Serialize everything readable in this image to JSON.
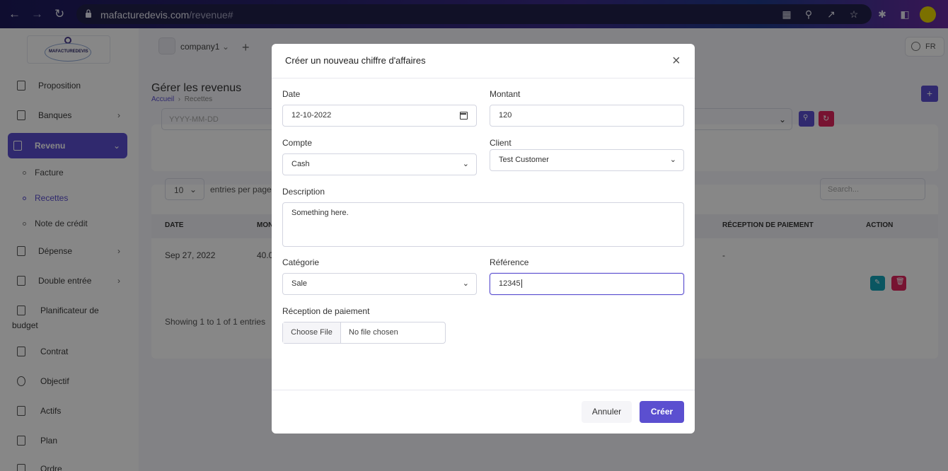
{
  "browser": {
    "url_host": "mafacturedevis.com",
    "url_path": "/revenue#"
  },
  "topbar": {
    "company": "company1",
    "lang": "FR"
  },
  "sidebar": {
    "items": [
      {
        "label": "Proposition"
      },
      {
        "label": "Banques"
      },
      {
        "label": "Revenu"
      },
      {
        "label": "Dépense"
      },
      {
        "label": "Double entrée"
      },
      {
        "label": "Planificateur de"
      },
      {
        "label": "budget"
      },
      {
        "label": "Contrat"
      },
      {
        "label": "Objectif"
      },
      {
        "label": "Actifs"
      },
      {
        "label": "Plan"
      },
      {
        "label": "Ordre"
      }
    ],
    "sub_items": [
      {
        "label": "Facture"
      },
      {
        "label": "Recettes"
      },
      {
        "label": "Note de crédit"
      }
    ]
  },
  "main": {
    "title": "Gérer les revenus",
    "breadcrumb_home": "Accueil",
    "breadcrumb_current": "Recettes",
    "filter_date_placeholder": "YYYY-MM-DD",
    "entries_value": "10",
    "entries_label": "entries per page",
    "search_placeholder": "Search...",
    "table_headers": [
      "DATE",
      "MON",
      "RÉCEPTION DE PAIEMENT",
      "ACTION"
    ],
    "row": {
      "date": "Sep 27, 2022",
      "amount": "40.0",
      "receipt": "-"
    },
    "showing": "Showing 1 to 1 of 1 entries"
  },
  "modal": {
    "title": "Créer un nouveau chiffre d'affaires",
    "close": "×",
    "date_label": "Date",
    "date_value": "12-10-2022",
    "amount_label": "Montant",
    "amount_value": "120",
    "account_label": "Compte",
    "account_value": "Cash",
    "client_label": "Client",
    "client_value": "Test Customer",
    "description_label": "Description",
    "description_value": "Something here.",
    "category_label": "Catégorie",
    "category_value": "Sale",
    "reference_label": "Référence",
    "reference_value": "12345",
    "payment_label": "Réception de paiement",
    "file_button": "Choose File",
    "file_status": "No file chosen",
    "cancel": "Annuler",
    "create": "Créer"
  },
  "colors": {
    "accent": "#5b4fd0",
    "danger": "#e0245e",
    "teal": "#14a3b8"
  }
}
